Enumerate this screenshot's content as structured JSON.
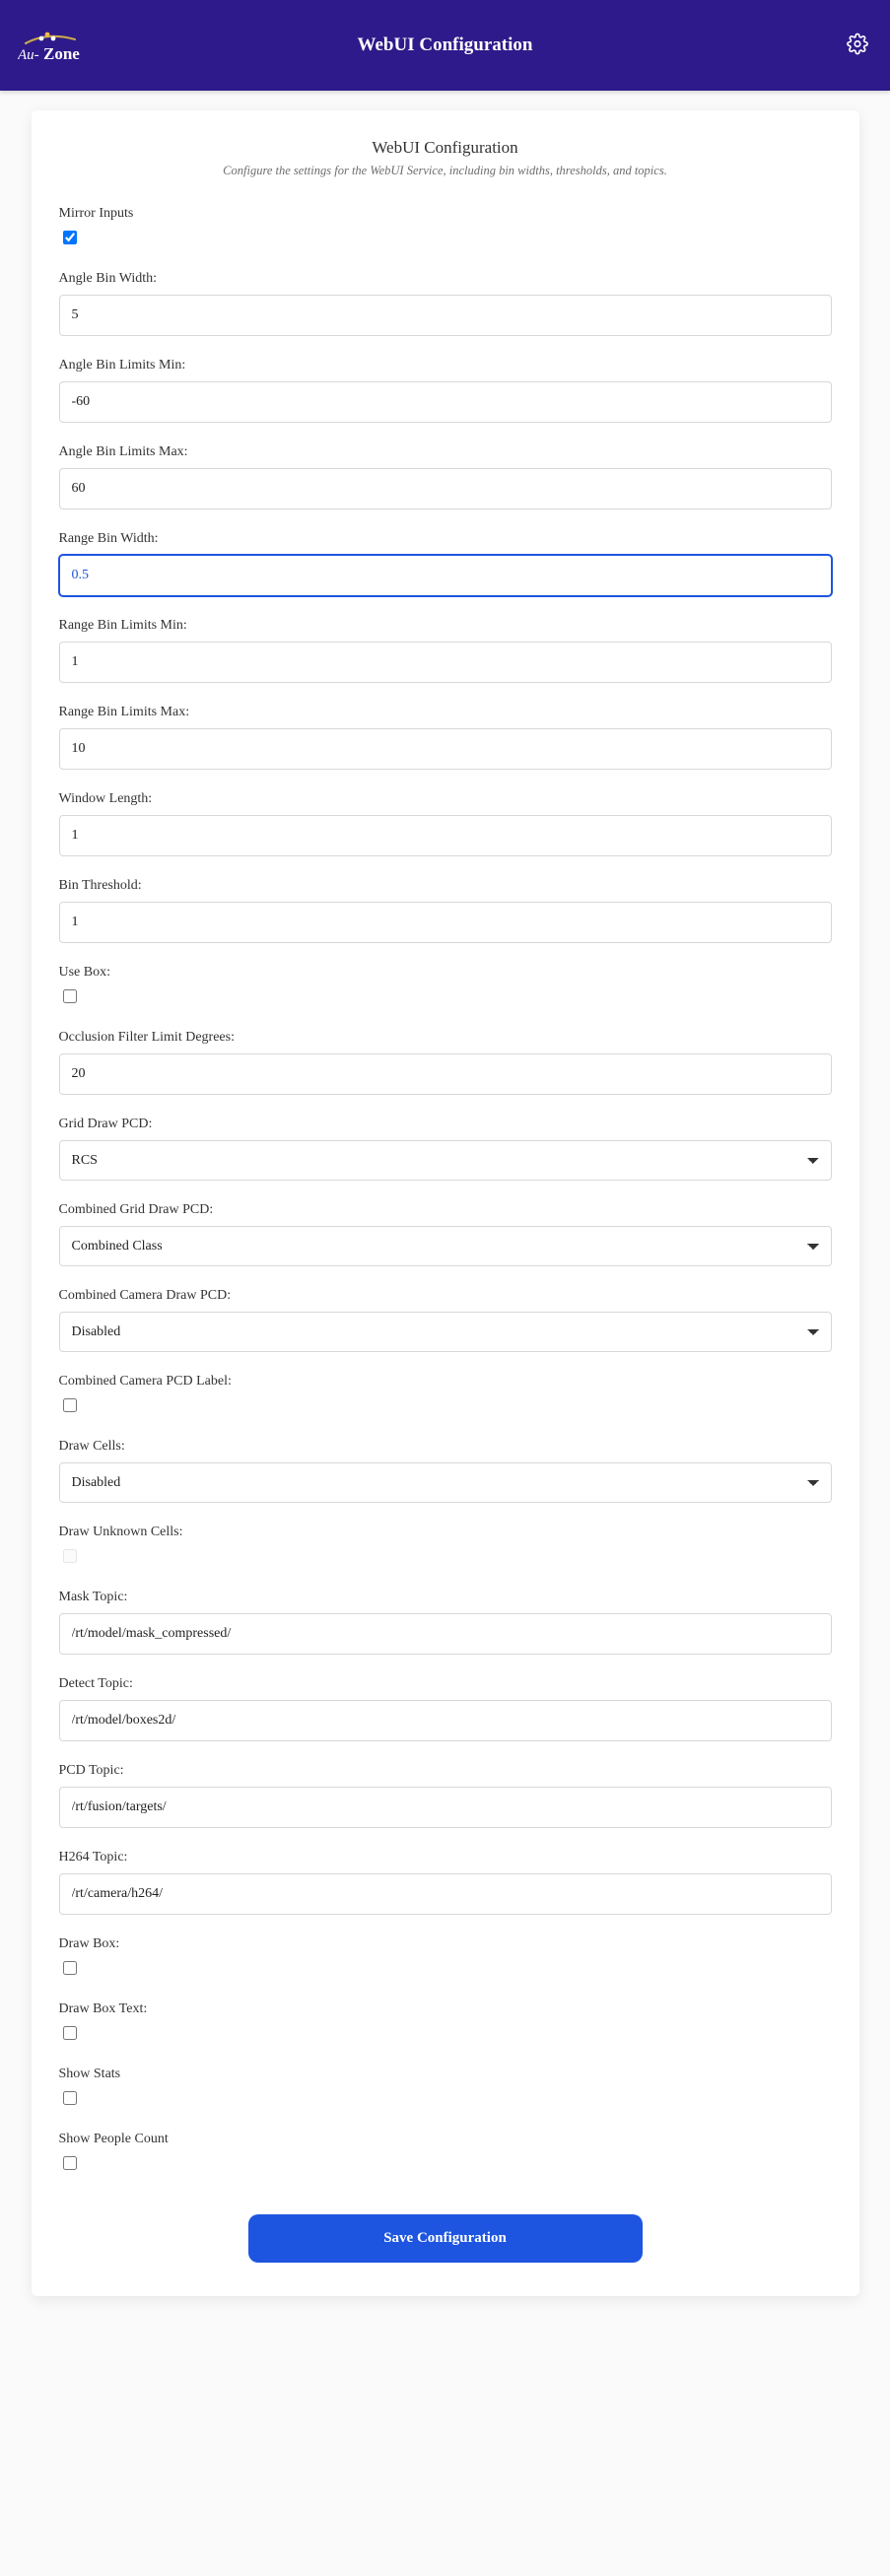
{
  "header": {
    "title": "WebUI Configuration",
    "brand_top": "Au-",
    "brand_bottom": "Zone"
  },
  "card": {
    "title": "WebUI Configuration",
    "subtitle": "Configure the settings for the WebUI Service, including bin widths, thresholds, and topics."
  },
  "fields": {
    "mirror_inputs": {
      "label": "Mirror Inputs",
      "checked": true
    },
    "angle_bin_width": {
      "label": "Angle Bin Width:",
      "value": "5"
    },
    "angle_bin_min": {
      "label": "Angle Bin Limits Min:",
      "value": "-60"
    },
    "angle_bin_max": {
      "label": "Angle Bin Limits Max:",
      "value": "60"
    },
    "range_bin_width": {
      "label": "Range Bin Width:",
      "value": "0.5"
    },
    "range_bin_min": {
      "label": "Range Bin Limits Min:",
      "value": "1"
    },
    "range_bin_max": {
      "label": "Range Bin Limits Max:",
      "value": "10"
    },
    "window_length": {
      "label": "Window Length:",
      "value": "1"
    },
    "bin_threshold": {
      "label": "Bin Threshold:",
      "value": "1"
    },
    "use_box": {
      "label": "Use Box:",
      "checked": false
    },
    "occlusion_limit": {
      "label": "Occlusion Filter Limit Degrees:",
      "value": "20"
    },
    "grid_draw_pcd": {
      "label": "Grid Draw PCD:",
      "value": "RCS"
    },
    "combined_grid_draw_pcd": {
      "label": "Combined Grid Draw PCD:",
      "value": "Combined Class"
    },
    "combined_camera_draw_pcd": {
      "label": "Combined Camera Draw PCD:",
      "value": "Disabled"
    },
    "combined_camera_pcd_label": {
      "label": "Combined Camera PCD Label:",
      "checked": false
    },
    "draw_cells": {
      "label": "Draw Cells:",
      "value": "Disabled"
    },
    "draw_unknown_cells": {
      "label": "Draw Unknown Cells:",
      "checked": false,
      "disabled": true
    },
    "mask_topic": {
      "label": "Mask Topic:",
      "value": "/rt/model/mask_compressed/"
    },
    "detect_topic": {
      "label": "Detect Topic:",
      "value": "/rt/model/boxes2d/"
    },
    "pcd_topic": {
      "label": "PCD Topic:",
      "value": "/rt/fusion/targets/"
    },
    "h264_topic": {
      "label": "H264 Topic:",
      "value": "/rt/camera/h264/"
    },
    "draw_box": {
      "label": "Draw Box:",
      "checked": false
    },
    "draw_box_text": {
      "label": "Draw Box Text:",
      "checked": false
    },
    "show_stats": {
      "label": "Show Stats",
      "checked": false
    },
    "show_people_count": {
      "label": "Show People Count",
      "checked": false
    }
  },
  "actions": {
    "save": "Save Configuration"
  }
}
